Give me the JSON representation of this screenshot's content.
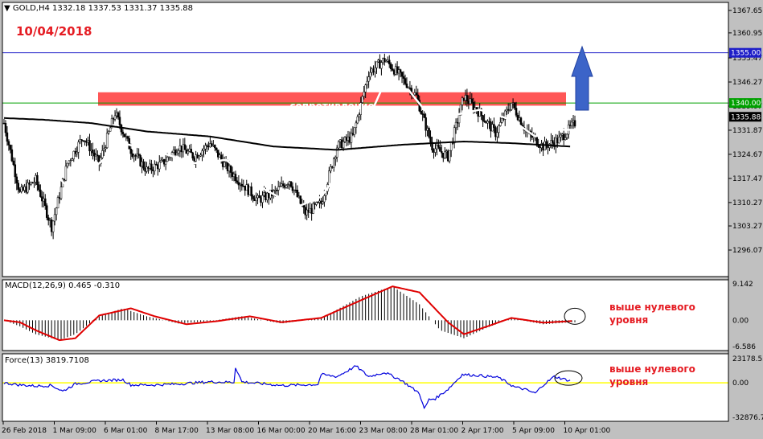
{
  "header": {
    "symbol_label": "GOLD,H4",
    "ohlc": "1332.18 1337.53 1331.37 1335.88",
    "date": "10/04/2018"
  },
  "main_panel": {
    "resistance_label": "сопротивление",
    "level_upper": "1355.00",
    "level_lower": "1340.00",
    "current_price": "1335.88",
    "price_ticks": [
      "1367.65",
      "1360.95",
      "1353.47",
      "1346.27",
      "1339.07",
      "1331.87",
      "1324.67",
      "1317.47",
      "1310.27",
      "1303.27",
      "1296.07"
    ],
    "colors": {
      "bull": "#ffffff",
      "bear": "#000000",
      "sma_fast": "#ffffff",
      "sma_slow": "#000000",
      "level_upper": "#1e1ec8",
      "level_lower": "#00a000",
      "arrow": "#3c64c8",
      "band": "#ff4444"
    }
  },
  "macd_panel": {
    "label": "MACD(12,26,9) 0.465 -0.310",
    "ticks": [
      "9.142",
      "0.00",
      "-6.586"
    ],
    "annotation": [
      "выше нулевого",
      "уровня"
    ]
  },
  "force_panel": {
    "label": "Force(13) 3819.7108",
    "ticks": [
      "23178.55",
      "0.00",
      "-32876.77"
    ],
    "annotation": [
      "выше нулевого",
      "уровня"
    ]
  },
  "time_axis": [
    "26 Feb 2018",
    "1 Mar 09:00",
    "6 Mar 01:00",
    "8 Mar 17:00",
    "13 Mar 08:00",
    "16 Mar 00:00",
    "20 Mar 16:00",
    "23 Mar 08:00",
    "28 Mar 01:00",
    "2 Apr 17:00",
    "5 Apr 09:00",
    "10 Apr 01:00"
  ],
  "chart_data": {
    "type": "candlestick",
    "price_anchors": [
      [
        0,
        1334
      ],
      [
        10,
        1313
      ],
      [
        20,
        1317
      ],
      [
        30,
        1303
      ],
      [
        40,
        1322
      ],
      [
        50,
        1330
      ],
      [
        60,
        1322
      ],
      [
        70,
        1337
      ],
      [
        80,
        1326
      ],
      [
        90,
        1320
      ],
      [
        100,
        1322
      ],
      [
        110,
        1327
      ],
      [
        120,
        1324
      ],
      [
        130,
        1328
      ],
      [
        140,
        1321
      ],
      [
        150,
        1316
      ],
      [
        160,
        1311
      ],
      [
        170,
        1313
      ],
      [
        180,
        1317
      ],
      [
        190,
        1307
      ],
      [
        200,
        1310
      ],
      [
        210,
        1327
      ],
      [
        220,
        1330
      ],
      [
        230,
        1349
      ],
      [
        240,
        1353
      ],
      [
        250,
        1348
      ],
      [
        260,
        1342
      ],
      [
        270,
        1327
      ],
      [
        280,
        1324
      ],
      [
        290,
        1342
      ],
      [
        300,
        1337
      ],
      [
        310,
        1331
      ],
      [
        320,
        1340
      ],
      [
        330,
        1331
      ],
      [
        340,
        1327
      ],
      [
        350,
        1329
      ],
      [
        360,
        1334
      ]
    ],
    "n_candles": 361,
    "sma_fast_anchors": [
      [
        0,
        1336
      ],
      [
        20,
        1325
      ],
      [
        40,
        1315
      ],
      [
        60,
        1322
      ],
      [
        75,
        1328
      ],
      [
        100,
        1325
      ],
      [
        120,
        1322
      ],
      [
        140,
        1323
      ],
      [
        165,
        1314
      ],
      [
        185,
        1309
      ],
      [
        200,
        1312
      ],
      [
        220,
        1325
      ],
      [
        240,
        1346
      ],
      [
        255,
        1344
      ],
      [
        270,
        1335
      ],
      [
        290,
        1337
      ],
      [
        300,
        1338
      ],
      [
        320,
        1335
      ],
      [
        335,
        1330
      ],
      [
        350,
        1332
      ],
      [
        360,
        1332
      ]
    ],
    "sma_slow_anchors": [
      [
        0,
        1335.5
      ],
      [
        25,
        1335
      ],
      [
        55,
        1334
      ],
      [
        90,
        1331.5
      ],
      [
        130,
        1330
      ],
      [
        170,
        1327
      ],
      [
        210,
        1326
      ],
      [
        250,
        1327.5
      ],
      [
        290,
        1328.5
      ],
      [
        320,
        1328
      ],
      [
        357,
        1327
      ]
    ],
    "macd_histogram_anchors": [
      [
        0,
        0
      ],
      [
        10,
        -1.5
      ],
      [
        20,
        -3.5
      ],
      [
        35,
        -5
      ],
      [
        45,
        -3.5
      ],
      [
        60,
        1
      ],
      [
        75,
        3
      ],
      [
        90,
        1
      ],
      [
        110,
        -0.8
      ],
      [
        130,
        -0.2
      ],
      [
        150,
        1
      ],
      [
        175,
        -0.8
      ],
      [
        200,
        0.5
      ],
      [
        225,
        6
      ],
      [
        245,
        8.5
      ],
      [
        262,
        4
      ],
      [
        275,
        -2.5
      ],
      [
        290,
        -4.5
      ],
      [
        305,
        -1.8
      ],
      [
        320,
        0.5
      ],
      [
        340,
        -1
      ],
      [
        358,
        -0.5
      ]
    ],
    "macd_signal_anchors": [
      [
        0,
        0
      ],
      [
        10,
        -0.5
      ],
      [
        20,
        -2.5
      ],
      [
        35,
        -5
      ],
      [
        45,
        -4.5
      ],
      [
        60,
        1.2
      ],
      [
        80,
        3
      ],
      [
        95,
        1
      ],
      [
        115,
        -1
      ],
      [
        135,
        -0.2
      ],
      [
        155,
        1
      ],
      [
        175,
        -0.5
      ],
      [
        200,
        0.6
      ],
      [
        225,
        5
      ],
      [
        245,
        8.5
      ],
      [
        262,
        7
      ],
      [
        280,
        -0.5
      ],
      [
        290,
        -3.5
      ],
      [
        305,
        -1.5
      ],
      [
        320,
        0.6
      ],
      [
        340,
        -0.6
      ],
      [
        358,
        -0.2
      ]
    ],
    "force_anchors": [
      [
        0,
        0
      ],
      [
        10,
        -2000
      ],
      [
        20,
        -3000
      ],
      [
        30,
        -2500
      ],
      [
        37,
        -8000
      ],
      [
        45,
        -1000
      ],
      [
        60,
        2000
      ],
      [
        75,
        3000
      ],
      [
        80,
        -2000
      ],
      [
        95,
        -2000
      ],
      [
        110,
        -1000
      ],
      [
        130,
        1000
      ],
      [
        145,
        500
      ],
      [
        146,
        15000
      ],
      [
        150,
        1000
      ],
      [
        175,
        -2500
      ],
      [
        198,
        -1500
      ],
      [
        200,
        8000
      ],
      [
        210,
        6000
      ],
      [
        222,
        16000
      ],
      [
        230,
        6000
      ],
      [
        240,
        10000
      ],
      [
        250,
        3000
      ],
      [
        262,
        -10000
      ],
      [
        265,
        -25000
      ],
      [
        268,
        -16000
      ],
      [
        272,
        -15000
      ],
      [
        280,
        -6000
      ],
      [
        289,
        8000
      ],
      [
        300,
        7000
      ],
      [
        312,
        5000
      ],
      [
        322,
        -4000
      ],
      [
        328,
        -6000
      ],
      [
        335,
        -10000
      ],
      [
        340,
        -2000
      ],
      [
        347,
        6000
      ],
      [
        357,
        2000
      ]
    ],
    "ranges": {
      "price": [
        1296.07,
        1367.65
      ],
      "macd": [
        -6.586,
        9.142
      ],
      "force": [
        -32876.77,
        23178.55
      ]
    },
    "levels": {
      "upper": 1355.0,
      "lower": 1340.0,
      "band_top": 1343.2,
      "band_bottom": 1339.2,
      "current": 1335.88
    },
    "series": [
      {
        "name": "GOLD,H4"
      },
      {
        "name": "MACD(12,26,9)"
      },
      {
        "name": "Force(13)"
      }
    ]
  }
}
